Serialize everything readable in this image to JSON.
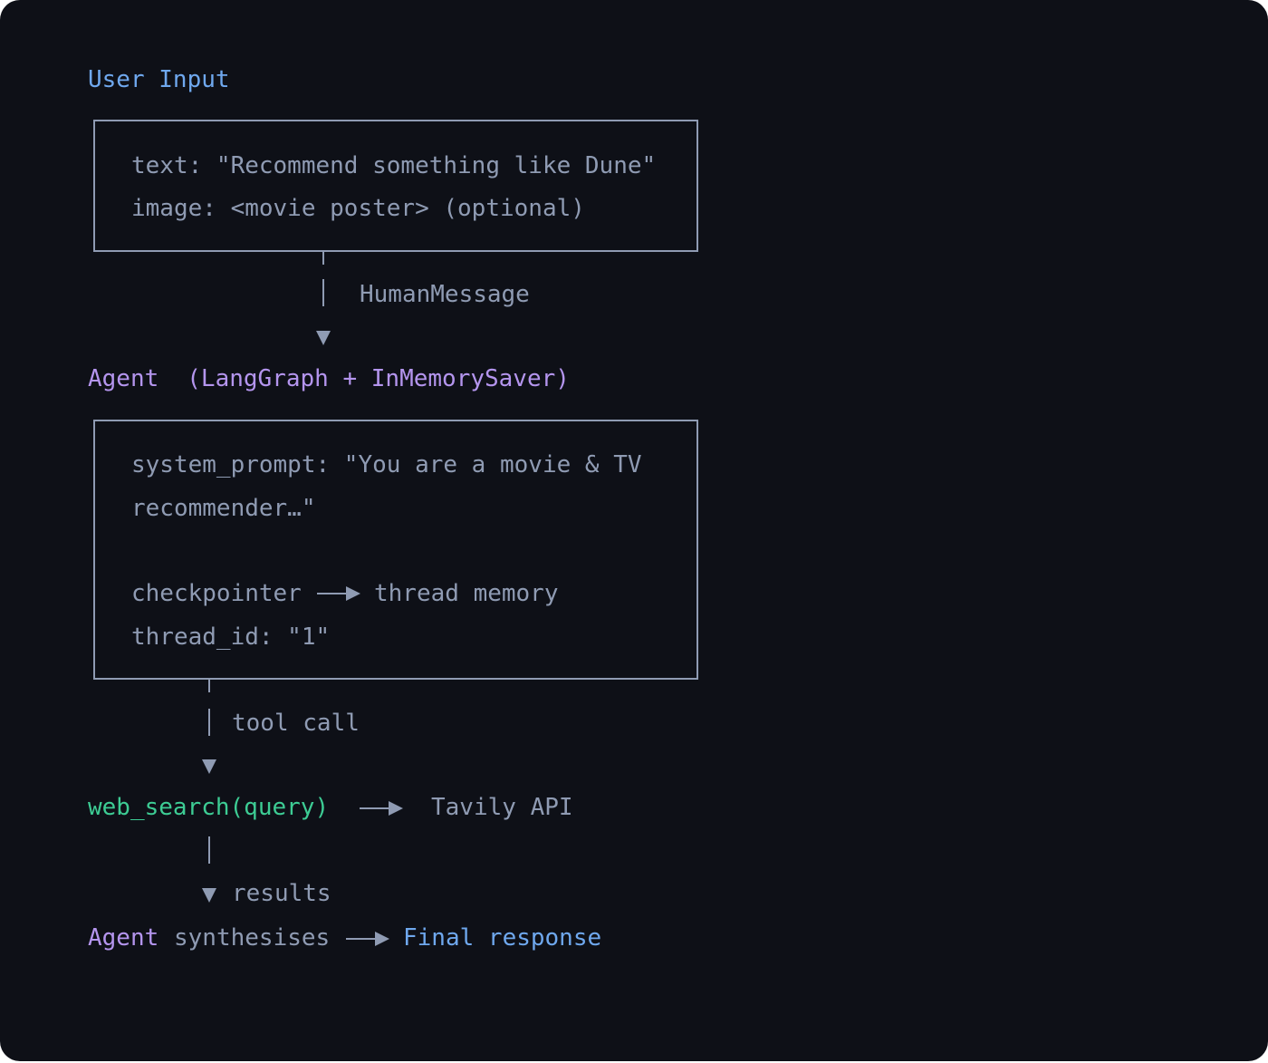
{
  "input": {
    "title": "User Input",
    "line1": "text: \"Recommend something like Dune\"",
    "line2": "image: <movie poster> (optional)"
  },
  "edge1": {
    "label": "HumanMessage"
  },
  "agent": {
    "title_name": "Agent",
    "title_detail": "(LangGraph + InMemorySaver)",
    "line1": "system_prompt: \"You are a movie & TV",
    "line2": "recommender…\"",
    "line3_left": "checkpointer",
    "line3_right": "thread memory",
    "line4": "thread_id: \"1\""
  },
  "edge2": {
    "label": "tool call"
  },
  "tool": {
    "call": "web_search(query)",
    "target": "Tavily API"
  },
  "edge3": {
    "label": "results"
  },
  "final": {
    "agent": "Agent",
    "verb": "synthesises",
    "response": "Final response"
  },
  "colors": {
    "background": "#0e1017",
    "blue": "#6fa8ee",
    "purple": "#b495ee",
    "green": "#3dcc94",
    "gray": "#8f9bb3"
  }
}
